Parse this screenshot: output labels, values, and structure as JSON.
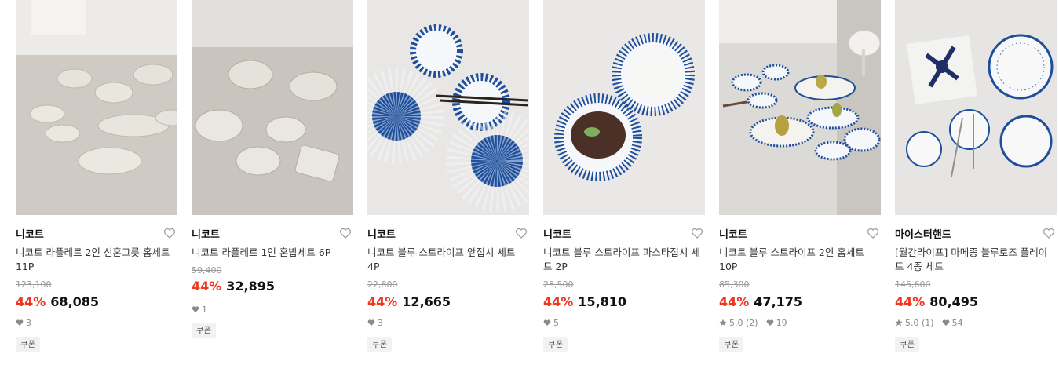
{
  "icons": {
    "wishlist": "heart-outline-icon",
    "likes": "heart-filled-icon",
    "rating": "star-icon"
  },
  "colors": {
    "discount": "#f0361d",
    "accent_blue": "#1e4f9c"
  },
  "products": [
    {
      "brand": "니코트",
      "title": "니코트 라플레르 2인 신혼그릇 홈세트 11P",
      "original_price": "123,100",
      "discount_rate": "44%",
      "price": "68,085",
      "rating": null,
      "likes": "3",
      "coupon": "쿠폰"
    },
    {
      "brand": "니코트",
      "title": "니코트 라플레르 1인 혼밥세트 6P",
      "original_price": "59,400",
      "discount_rate": "44%",
      "price": "32,895",
      "rating": null,
      "likes": "1",
      "coupon": "쿠폰"
    },
    {
      "brand": "니코트",
      "title": "니코트 블루 스트라이프 앞접시 세트 4P",
      "original_price": "22,800",
      "discount_rate": "44%",
      "price": "12,665",
      "rating": null,
      "likes": "3",
      "coupon": "쿠폰"
    },
    {
      "brand": "니코트",
      "title": "니코트 블루 스트라이프 파스타접시 세트 2P",
      "original_price": "28,500",
      "discount_rate": "44%",
      "price": "15,810",
      "rating": null,
      "likes": "5",
      "coupon": "쿠폰"
    },
    {
      "brand": "니코트",
      "title": "니코트 블루 스트라이프 2인 홈세트 10P",
      "original_price": "85,300",
      "discount_rate": "44%",
      "price": "47,175",
      "rating": "5.0 (2)",
      "likes": "19",
      "coupon": "쿠폰"
    },
    {
      "brand": "마이스터핸드",
      "title": "[월간라이프] 마메종 블루로즈 플레이트 4종 세트",
      "original_price": "145,600",
      "discount_rate": "44%",
      "price": "80,495",
      "rating": "5.0 (1)",
      "likes": "54",
      "coupon": "쿠폰"
    }
  ]
}
